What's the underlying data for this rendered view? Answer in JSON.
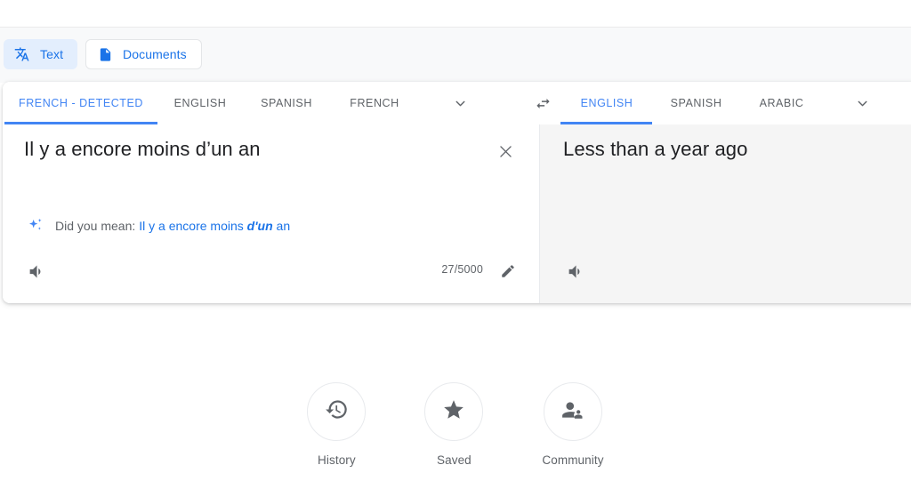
{
  "theme": {
    "accent_blue": "#1a73e8",
    "tab_blue": "#4285f4",
    "chip_bg": "#e3eefd",
    "bar_bg": "#f8f9fa",
    "target_pane_bg": "#f5f5f5",
    "muted_text": "#5f6368",
    "primary_text": "#202124"
  },
  "mode_bar": {
    "tabs": [
      {
        "label": "Text",
        "icon": "translate-icon",
        "selected": true
      },
      {
        "label": "Documents",
        "icon": "document-icon",
        "selected": false
      }
    ]
  },
  "source_panel": {
    "language_tabs": [
      {
        "label": "FRENCH - DETECTED",
        "active": true
      },
      {
        "label": "ENGLISH",
        "active": false
      },
      {
        "label": "SPANISH",
        "active": false
      },
      {
        "label": "FRENCH",
        "active": false
      }
    ],
    "more_languages_icon": "chevron-down-icon",
    "text": "Il y a encore moins d’un an",
    "placeholder": "Enter text",
    "clear_icon": "close-icon",
    "did_you_mean": {
      "icon": "sparkle-icon",
      "label": "Did you mean:",
      "suggestion_prefix": "Il y a encore moins ",
      "suggestion_emphasis": "d'un",
      "suggestion_suffix": " an"
    },
    "listen_icon": "speaker-icon",
    "char_count": "27/5000",
    "edit_icon": "pencil-icon"
  },
  "swap": {
    "icon": "swap-languages-icon"
  },
  "target_panel": {
    "language_tabs": [
      {
        "label": "ENGLISH",
        "active": true
      },
      {
        "label": "SPANISH",
        "active": false
      },
      {
        "label": "ARABIC",
        "active": false
      }
    ],
    "more_languages_icon": "chevron-down-icon",
    "text": "Less than a year ago",
    "listen_icon": "speaker-icon"
  },
  "shortcuts": [
    {
      "label": "History",
      "icon": "history-icon"
    },
    {
      "label": "Saved",
      "icon": "star-icon"
    },
    {
      "label": "Community",
      "icon": "community-icon"
    }
  ]
}
